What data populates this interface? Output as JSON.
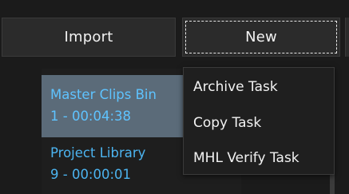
{
  "toolbar": {
    "import_label": "Import",
    "new_label": "New"
  },
  "bins": [
    {
      "name": "Master Clips Bin",
      "meta": "1 - 00:04:38",
      "selected": true
    },
    {
      "name": "Project Library",
      "meta": "9 - 00:00:01",
      "selected": false
    }
  ],
  "new_menu": {
    "items": [
      {
        "label": "Archive Task"
      },
      {
        "label": "Copy Task"
      },
      {
        "label": "MHL Verify Task"
      }
    ]
  },
  "colors": {
    "background": "#1b1b1b",
    "button_bg": "#2b2b2b",
    "bin_text": "#4cb4f0",
    "bin_selected_bg": "#5b6b79",
    "menu_bg": "#1f1f1f",
    "menu_text": "#f2f2f2"
  }
}
